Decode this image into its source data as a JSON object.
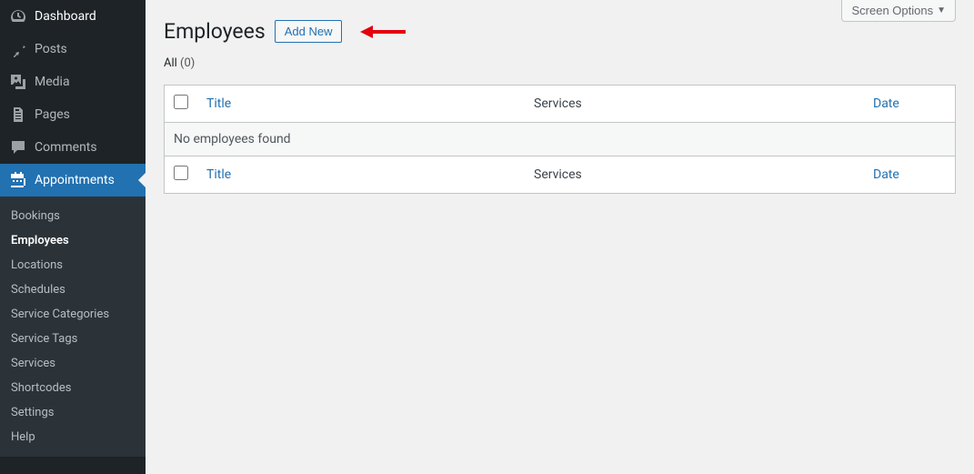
{
  "sidebar": {
    "items": [
      {
        "label": "Dashboard"
      },
      {
        "label": "Posts"
      },
      {
        "label": "Media"
      },
      {
        "label": "Pages"
      },
      {
        "label": "Comments"
      },
      {
        "label": "Appointments"
      }
    ],
    "submenu": [
      {
        "label": "Bookings"
      },
      {
        "label": "Employees"
      },
      {
        "label": "Locations"
      },
      {
        "label": "Schedules"
      },
      {
        "label": "Service Categories"
      },
      {
        "label": "Service Tags"
      },
      {
        "label": "Services"
      },
      {
        "label": "Shortcodes"
      },
      {
        "label": "Settings"
      },
      {
        "label": "Help"
      }
    ]
  },
  "screen_options": {
    "label": "Screen Options"
  },
  "page": {
    "heading": "Employees",
    "add_new": "Add New",
    "filter_all_label": "All",
    "filter_all_count": "(0)"
  },
  "table": {
    "col_title": "Title",
    "col_services": "Services",
    "col_date": "Date",
    "empty_message": "No employees found"
  }
}
